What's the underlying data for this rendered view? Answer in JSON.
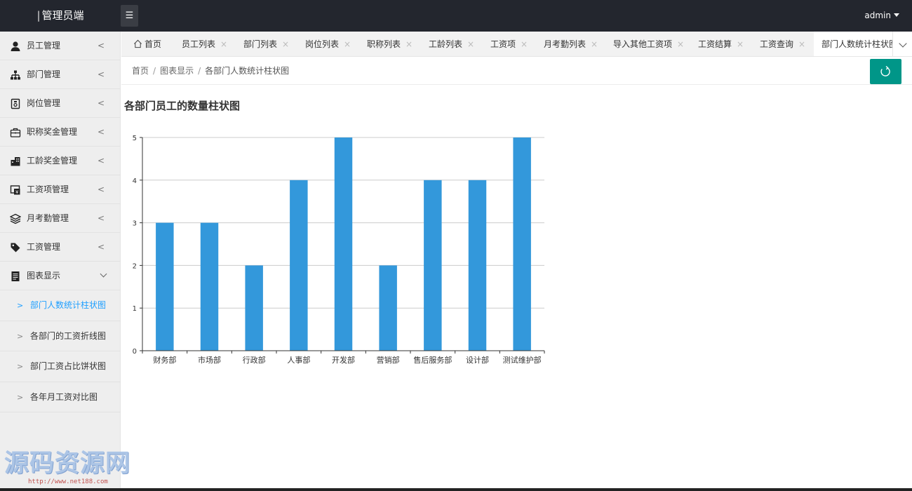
{
  "header": {
    "brand": "管理员端",
    "brand_bar": "|",
    "menu_toggle_icon": "☰",
    "user": "admin"
  },
  "sidebar": {
    "items": [
      {
        "label": "员工管理",
        "icon": "user-icon"
      },
      {
        "label": "部门管理",
        "icon": "sitemap-icon"
      },
      {
        "label": "岗位管理",
        "icon": "badge-icon"
      },
      {
        "label": "职称奖金管理",
        "icon": "briefcase-icon"
      },
      {
        "label": "工龄奖金管理",
        "icon": "building-icon"
      },
      {
        "label": "工资项管理",
        "icon": "money-icon"
      },
      {
        "label": "月考勤管理",
        "icon": "layers-icon"
      },
      {
        "label": "工资管理",
        "icon": "tag-icon"
      },
      {
        "label": "图表显示",
        "icon": "document-icon"
      }
    ],
    "collapse_chevron": "<",
    "sub_arrow": ">",
    "subitems": [
      {
        "label": "部门人数统计柱状图"
      },
      {
        "label": "各部门的工资折线图"
      },
      {
        "label": "部门工资占比饼状图"
      },
      {
        "label": "各年月工资对比图"
      }
    ]
  },
  "tabs": {
    "close_glyph": "×",
    "items": [
      {
        "label": "首页"
      },
      {
        "label": "员工列表"
      },
      {
        "label": "部门列表"
      },
      {
        "label": "岗位列表"
      },
      {
        "label": "职称列表"
      },
      {
        "label": "工龄列表"
      },
      {
        "label": "工资项"
      },
      {
        "label": "月考勤列表"
      },
      {
        "label": "导入其他工资项"
      },
      {
        "label": "工资结算"
      },
      {
        "label": "工资查询"
      },
      {
        "label": "部门人数统计柱状图"
      }
    ]
  },
  "breadcrumb": {
    "items": [
      "首页",
      "图表显示",
      "各部门人数统计柱状图"
    ],
    "separator": "/"
  },
  "chart_title": "各部门员工的数量柱状图",
  "chart_data": {
    "type": "bar",
    "categories": [
      "财务部",
      "市场部",
      "行政部",
      "人事部",
      "开发部",
      "营销部",
      "售后服务部",
      "设计部",
      "测试维护部"
    ],
    "values": [
      3,
      3,
      2,
      4,
      5,
      2,
      4,
      4,
      5
    ],
    "ylim": [
      0,
      5
    ],
    "yticks": [
      0,
      1,
      2,
      3,
      4,
      5
    ],
    "grid": true,
    "color": "#3398db"
  },
  "watermark": {
    "text": "源码资源网",
    "url": "http://www.net188.com"
  },
  "colors": {
    "topbar": "#23262e",
    "accent": "#009688",
    "active_link": "#1e9fff"
  }
}
